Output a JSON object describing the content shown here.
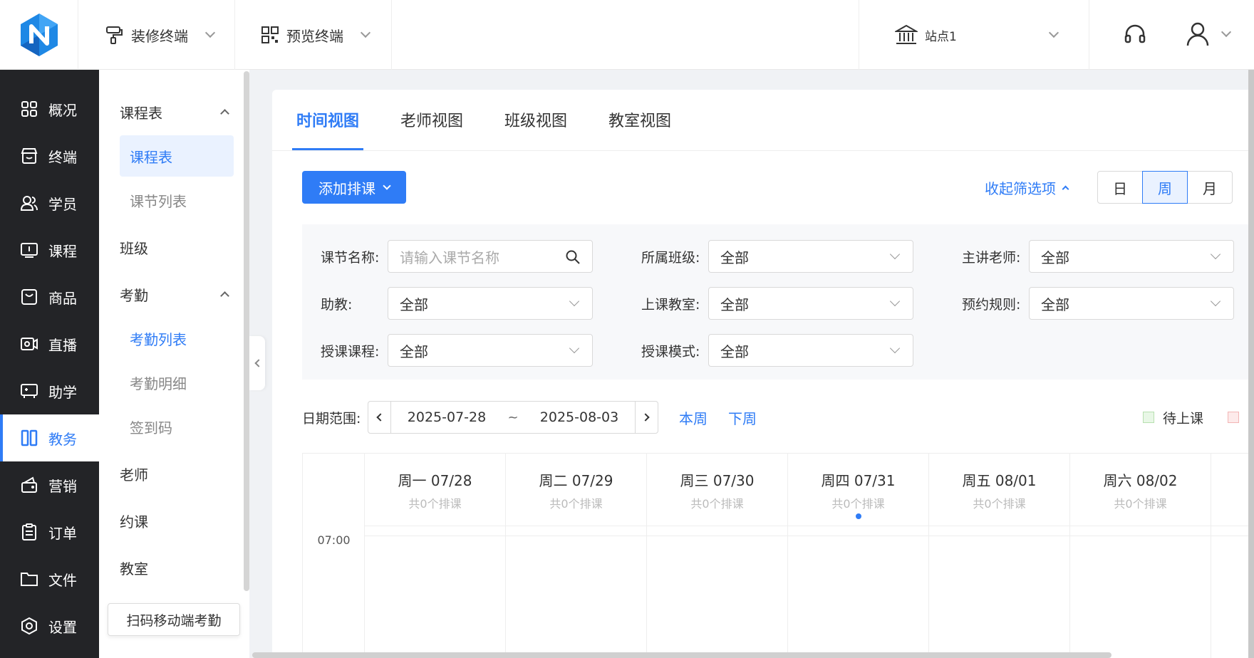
{
  "header": {
    "decorate_terminal": "装修终端",
    "preview_terminal": "预览终端",
    "site": "站点1"
  },
  "sidebar": {
    "items": [
      {
        "label": "概况",
        "icon": "dashboard-icon"
      },
      {
        "label": "终端",
        "icon": "store-icon"
      },
      {
        "label": "学员",
        "icon": "users-icon"
      },
      {
        "label": "课程",
        "icon": "book-icon"
      },
      {
        "label": "商品",
        "icon": "bag-icon"
      },
      {
        "label": "直播",
        "icon": "video-icon"
      },
      {
        "label": "助学",
        "icon": "gamepad-icon"
      },
      {
        "label": "教务",
        "icon": "columns-icon"
      },
      {
        "label": "营销",
        "icon": "gift-icon"
      },
      {
        "label": "订单",
        "icon": "clipboard-icon"
      },
      {
        "label": "文件",
        "icon": "folder-icon"
      },
      {
        "label": "设置",
        "icon": "settings-icon"
      }
    ]
  },
  "subnav": {
    "schedule_group": "课程表",
    "schedule": "课程表",
    "lesson_list": "课节列表",
    "class": "班级",
    "attendance_group": "考勤",
    "attendance_list": "考勤列表",
    "attendance_detail": "考勤明细",
    "checkin_code": "签到码",
    "teacher": "老师",
    "booking": "约课",
    "classroom": "教室",
    "tooltip": "扫码移动端考勤"
  },
  "tabs": [
    "时间视图",
    "老师视图",
    "班级视图",
    "教室视图"
  ],
  "toolbar": {
    "add_label": "添加排课",
    "collapse_filter": "收起筛选项",
    "view_day": "日",
    "view_week": "周",
    "view_month": "月"
  },
  "filters": {
    "lesson_name_label": "课节名称:",
    "lesson_name_placeholder": "请输入课节名称",
    "class_label": "所属班级:",
    "class_value": "全部",
    "lecturer_label": "主讲老师:",
    "lecturer_value": "全部",
    "assistant_label": "助教:",
    "assistant_value": "全部",
    "room_label": "上课教室:",
    "room_value": "全部",
    "booking_rule_label": "预约规则:",
    "booking_rule_value": "全部",
    "course_label": "授课课程:",
    "course_value": "全部",
    "mode_label": "授课模式:",
    "mode_value": "全部"
  },
  "date_range": {
    "label": "日期范围:",
    "start": "2025-07-28",
    "sep": "~",
    "end": "2025-08-03",
    "this_week": "本周",
    "next_week": "下周"
  },
  "legend": {
    "pending": "待上课",
    "pending_color": "#e8f7e6",
    "other_color": "#fdeaea"
  },
  "calendar": {
    "days": [
      {
        "title": "周一 07/28",
        "count": "共0个排课"
      },
      {
        "title": "周二 07/29",
        "count": "共0个排课"
      },
      {
        "title": "周三 07/30",
        "count": "共0个排课"
      },
      {
        "title": "周四 07/31",
        "count": "共0个排课"
      },
      {
        "title": "周五 08/01",
        "count": "共0个排课"
      },
      {
        "title": "周六 08/02",
        "count": "共0个排课"
      }
    ],
    "time": "07:00"
  },
  "colors": {
    "primary": "#2f7cf6",
    "sidebar_bg": "#232427"
  }
}
